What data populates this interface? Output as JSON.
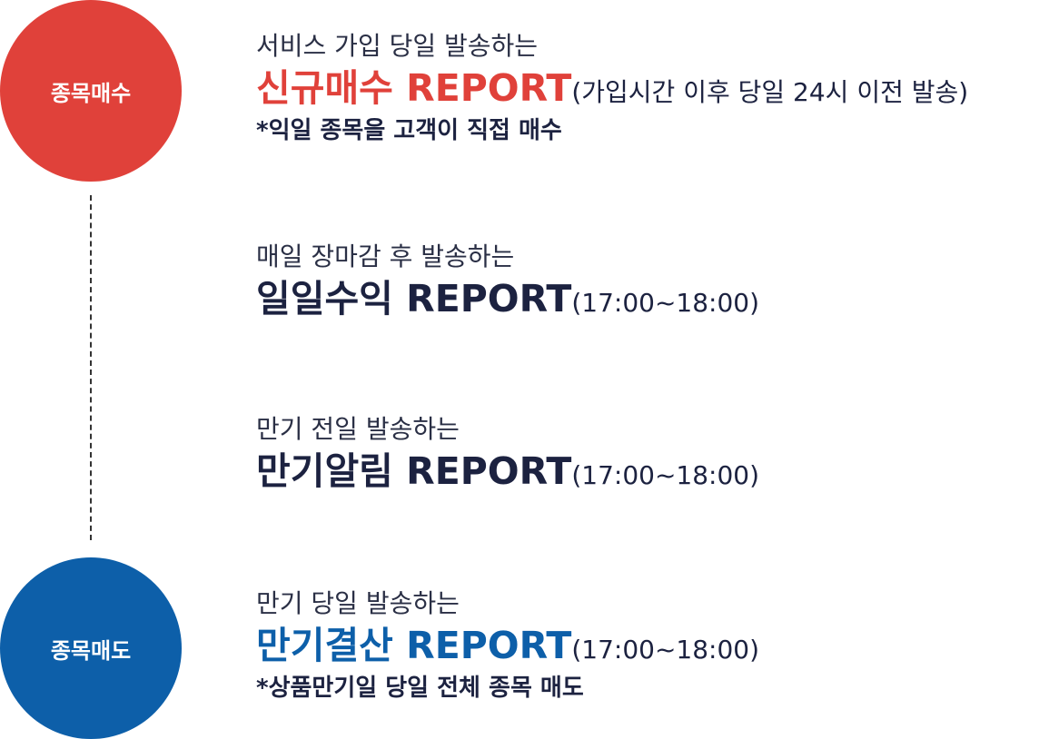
{
  "circles": {
    "buy_label": "종목매수",
    "sell_label": "종목매도"
  },
  "colors": {
    "accent_red": "#e0413a",
    "accent_blue": "#0d5fa9",
    "text_dark": "#1c2240"
  },
  "items": [
    {
      "subtitle": "서비스 가입 당일 발송하는",
      "name": "신규매수 REPORT",
      "extra": "(가입시간 이후 당일 24시 이전 발송)",
      "note": "*익일 종목을 고객이 직접 매수"
    },
    {
      "subtitle": "매일 장마감 후 발송하는",
      "name": "일일수익 REPORT",
      "extra": "(17:00~18:00)"
    },
    {
      "subtitle": "만기 전일 발송하는",
      "name": "만기알림 REPORT",
      "extra": "(17:00~18:00)"
    },
    {
      "subtitle": "만기 당일 발송하는",
      "name": "만기결산 REPORT",
      "extra": "(17:00~18:00)",
      "note": "*상품만기일 당일 전체 종목 매도"
    }
  ]
}
